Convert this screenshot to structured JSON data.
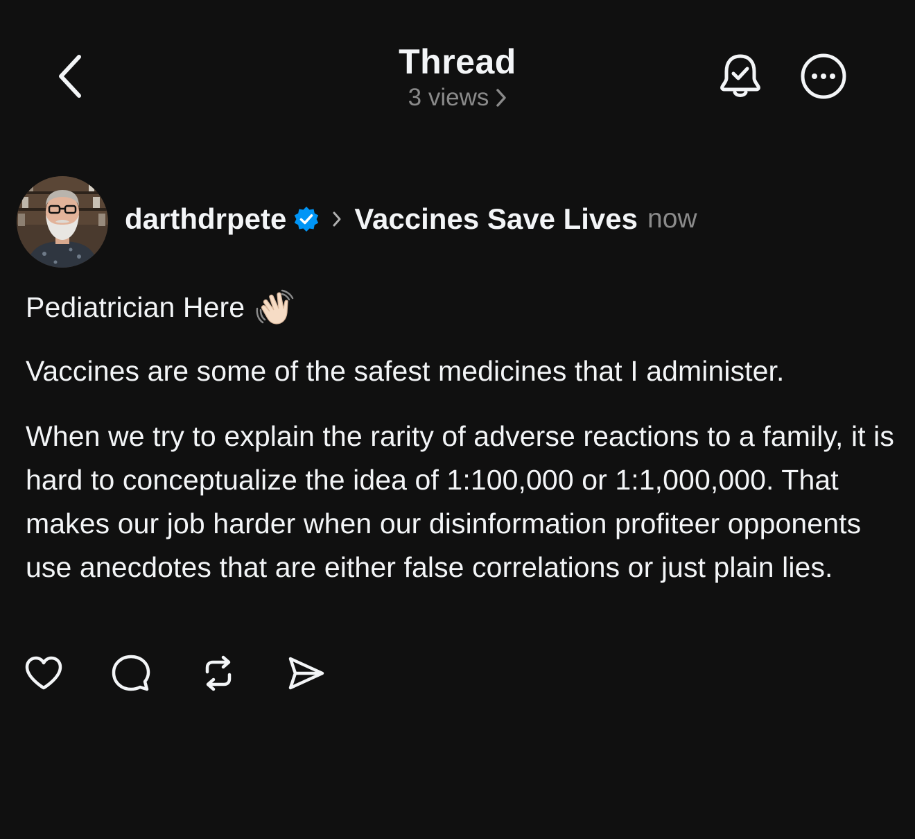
{
  "header": {
    "title": "Thread",
    "views": "3 views"
  },
  "post": {
    "username": "darthdrpete",
    "verified": true,
    "community": "Vaccines Save Lives",
    "timestamp": "now",
    "paragraphs": [
      "Pediatrician Here",
      "Vaccines are some of the safest medicines that I administer.",
      "When we try to explain the rarity of adverse reactions to a family, it is hard to conceptualize the idea of 1:100,000 or 1:1,000,000. That makes our job harder when our disinformation profiteer opponents use anecdotes that are either false correlations or just plain lies."
    ],
    "first_line_emoji": "waving-hand"
  },
  "icons": {
    "back": "chevron-left-icon",
    "bell": "bell-check-icon",
    "more": "more-circle-icon",
    "like": "heart-icon",
    "reply": "comment-bubble-icon",
    "repost": "repost-icon",
    "share": "send-icon"
  },
  "colors": {
    "background": "#101010",
    "text": "#f3f5f7",
    "secondary": "#8a8a8a",
    "verified": "#0095f6"
  }
}
